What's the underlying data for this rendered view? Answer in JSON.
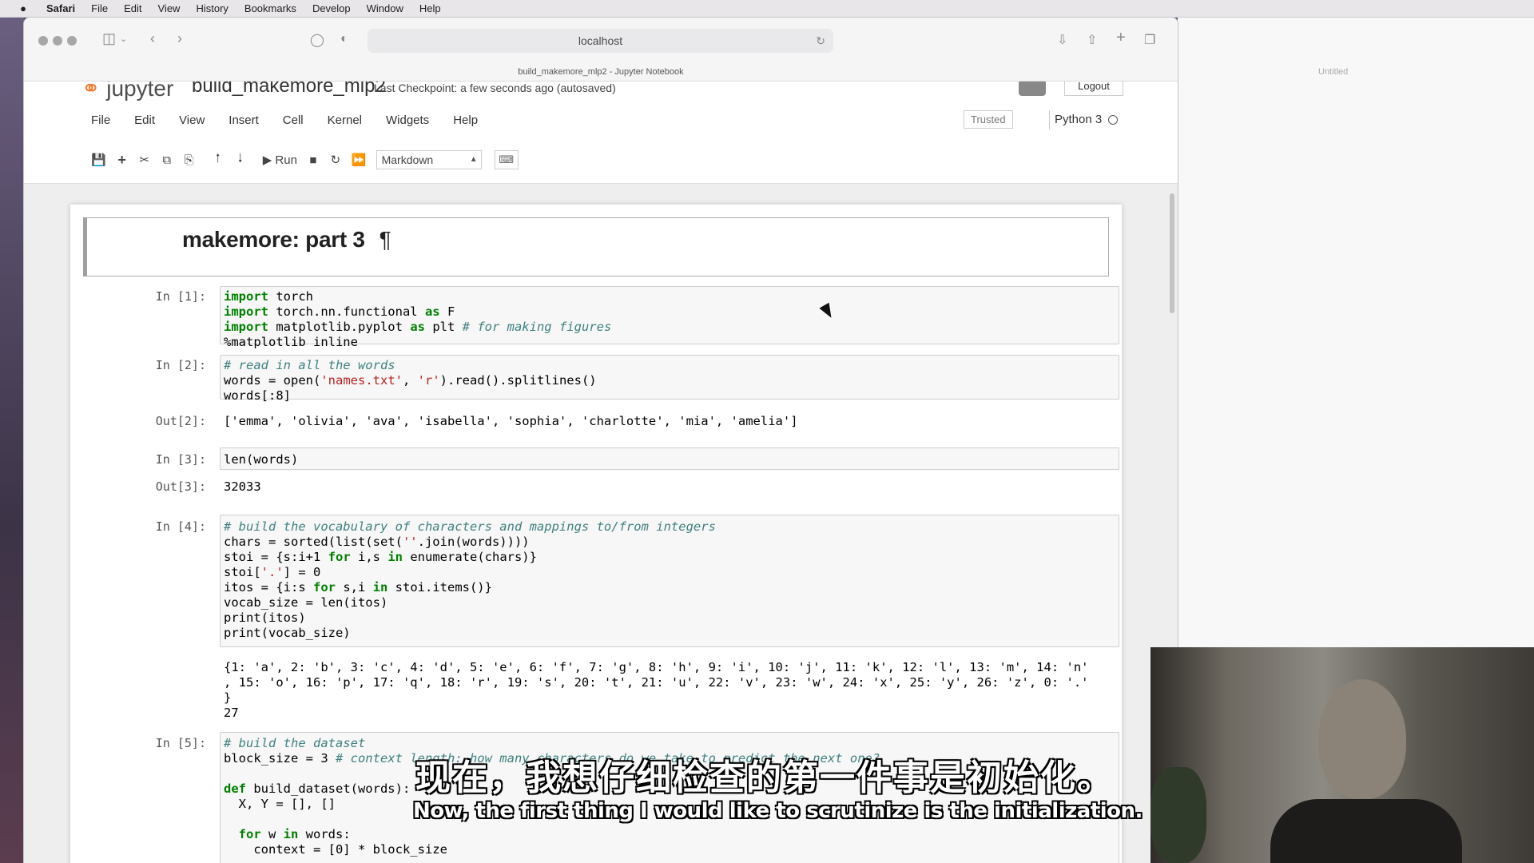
{
  "menubar": {
    "app": "Safari",
    "items": [
      "File",
      "Edit",
      "View",
      "History",
      "Bookmarks",
      "Develop",
      "Window",
      "Help"
    ]
  },
  "browser": {
    "url": "localhost",
    "tab_title": "build_makemore_mlp2 - Jupyter Notebook",
    "side_tab_title": "Untitled"
  },
  "jupyter": {
    "logo_text": "jupyter",
    "notebook_name": "build_makemore_mlp2",
    "checkpoint": "Last Checkpoint: a few seconds ago  (autosaved)",
    "logout": "Logout",
    "menu": [
      "File",
      "Edit",
      "View",
      "Insert",
      "Cell",
      "Kernel",
      "Widgets",
      "Help"
    ],
    "trusted": "Trusted",
    "kernel": "Python 3",
    "run_label": "Run",
    "cell_type": "Markdown"
  },
  "notebook": {
    "title": "makemore: part 3",
    "pilcrow": "¶",
    "cells": [
      {
        "prompt": "In [1]:"
      },
      {
        "prompt": "In [2]:",
        "out_prompt": "Out[2]:",
        "output": "['emma', 'olivia', 'ava', 'isabella', 'sophia', 'charlotte', 'mia', 'amelia']"
      },
      {
        "prompt": "In [3]:",
        "code": "len(words)",
        "out_prompt": "Out[3]:",
        "output": "32033"
      },
      {
        "prompt": "In [4]:",
        "output": "{1: 'a', 2: 'b', 3: 'c', 4: 'd', 5: 'e', 6: 'f', 7: 'g', 8: 'h', 9: 'i', 10: 'j', 11: 'k', 12: 'l', 13: 'm', 14: 'n'\n, 15: 'o', 16: 'p', 17: 'q', 18: 'r', 19: 's', 20: 't', 21: 'u', 22: 'v', 23: 'w', 24: 'x', 25: 'y', 26: 'z', 0: '.'\n}\n27"
      },
      {
        "prompt": "In [5]:"
      }
    ]
  },
  "subtitles": {
    "zh": "现在，我想仔细检查的第一件事是初始化。",
    "en": "Now, the first thing I would like to scrutinize is the initialization."
  },
  "colors": {
    "jupyter_orange": "#f37726",
    "code_keyword": "#008000",
    "code_comment": "#408080",
    "code_string": "#ba2121"
  }
}
